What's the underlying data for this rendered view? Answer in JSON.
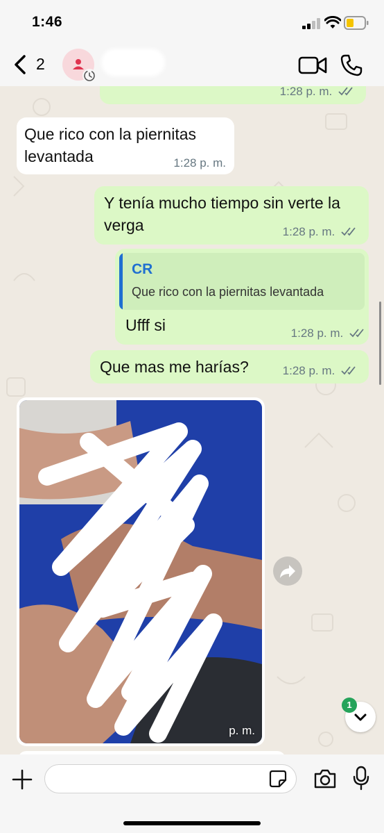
{
  "status_bar": {
    "time": "1:46"
  },
  "header": {
    "back_label": "back",
    "unread_count": "2",
    "icons": [
      "chevron-left-icon",
      "person-icon",
      "clock-icon",
      "video-icon",
      "phone-icon"
    ]
  },
  "messages": [
    {
      "direction": "outgoing",
      "text": "",
      "time": "1:28 p. m.",
      "status": "read"
    },
    {
      "direction": "incoming",
      "text": "Que rico con la piernitas levantada",
      "time": "1:28 p. m."
    },
    {
      "direction": "outgoing",
      "text": "Y tenía mucho tiempo sin verte la verga",
      "time": "1:28 p. m.",
      "status": "read"
    },
    {
      "direction": "outgoing",
      "reply_to": {
        "author": "CR",
        "text": "Que rico con la piernitas levantada"
      },
      "text": "Ufff si",
      "time": "1:28 p. m.",
      "status": "read"
    },
    {
      "direction": "outgoing",
      "text": "Que mas me harías?",
      "time": "1:28 p. m.",
      "status": "read"
    },
    {
      "direction": "incoming",
      "type": "image",
      "time": "p. m."
    }
  ],
  "scroll_down_badge": "1",
  "composer": {
    "placeholder": ""
  },
  "colors": {
    "chat_background": "#efeae2",
    "outgoing_bubble": "#dcf8c6",
    "incoming_bubble": "#ffffff",
    "read_ticks": "#667781",
    "reply_accent": "#1f6fd1",
    "badge": "#25a35a"
  }
}
